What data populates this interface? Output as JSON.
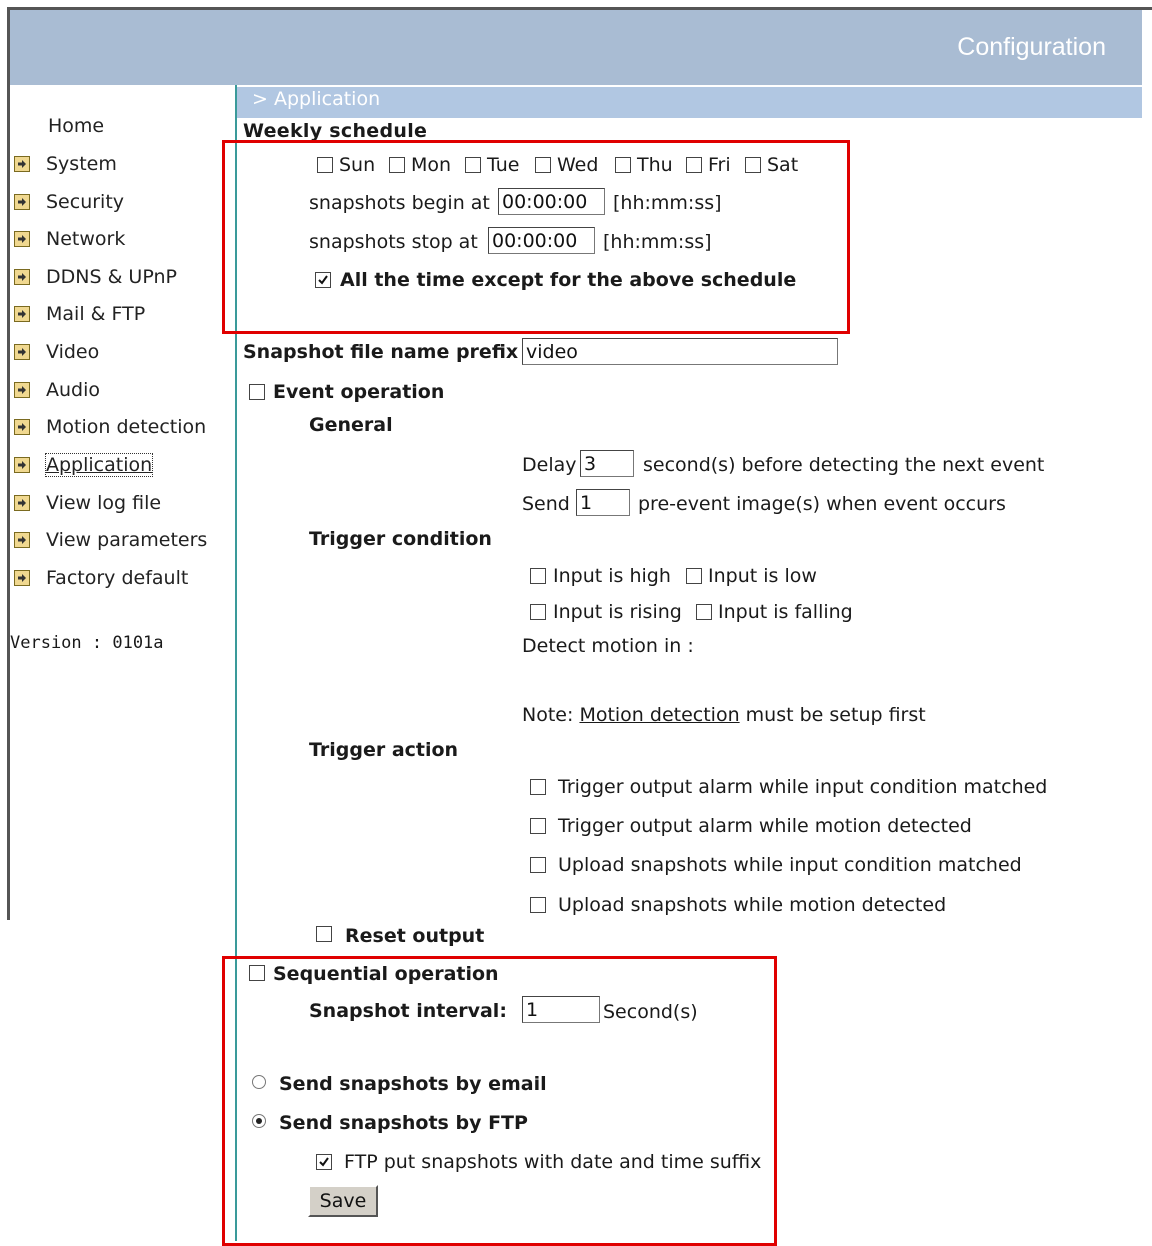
{
  "header": {
    "title": "Configuration"
  },
  "breadcrumb": "> Application",
  "sidebar": {
    "items": [
      {
        "label": "Home"
      },
      {
        "label": "System"
      },
      {
        "label": "Security"
      },
      {
        "label": "Network"
      },
      {
        "label": "DDNS & UPnP"
      },
      {
        "label": "Mail & FTP"
      },
      {
        "label": "Video"
      },
      {
        "label": "Audio"
      },
      {
        "label": "Motion detection"
      },
      {
        "label": "Application"
      },
      {
        "label": "View log file"
      },
      {
        "label": "View parameters"
      },
      {
        "label": "Factory default"
      }
    ],
    "version": "Version : 0101a"
  },
  "weekly": {
    "heading": "Weekly schedule",
    "days": [
      "Sun",
      "Mon",
      "Tue",
      "Wed",
      "Thu",
      "Fri",
      "Sat"
    ],
    "begin_label": "snapshots begin at",
    "begin_value": "00:00:00",
    "stop_label": "snapshots stop at",
    "stop_value": "00:00:00",
    "format_hint": "[hh:mm:ss]",
    "except_label": "All the time except for the above schedule",
    "except_checked": true
  },
  "prefix": {
    "label": "Snapshot file name prefix",
    "value": "video"
  },
  "event": {
    "label": "Event operation",
    "general_heading": "General",
    "delay_label": "Delay",
    "delay_value": "3",
    "delay_suffix": "second(s) before detecting the next event",
    "send_label": "Send",
    "send_value": "1",
    "send_suffix": "pre-event image(s) when event occurs",
    "trigger_condition_heading": "Trigger condition",
    "input_high": "Input is high",
    "input_low": "Input is low",
    "input_rising": "Input is rising",
    "input_falling": "Input is falling",
    "detect_motion": "Detect motion in :",
    "note_prefix": "Note:",
    "note_link": "Motion detection",
    "note_suffix": "must be setup first",
    "trigger_action_heading": "Trigger action",
    "actions": [
      "Trigger output alarm while input condition matched",
      "Trigger output alarm while motion detected",
      "Upload snapshots while input condition matched",
      "Upload snapshots while motion detected"
    ],
    "reset_output": "Reset output"
  },
  "sequential": {
    "label": "Sequential operation",
    "interval_label": "Snapshot interval:",
    "interval_value": "1",
    "interval_suffix": "Second(s)",
    "email_label": "Send snapshots by email",
    "ftp_label": "Send snapshots by FTP",
    "ftp_selected": true,
    "ftp_suffix_label": "FTP put snapshots with date and time suffix",
    "ftp_suffix_checked": true,
    "save_label": "Save"
  },
  "colors": {
    "header": "#a9bcd3",
    "section_bar": "#b1c7e2",
    "highlight": "#e00000",
    "divider": "#3a9a9a"
  }
}
